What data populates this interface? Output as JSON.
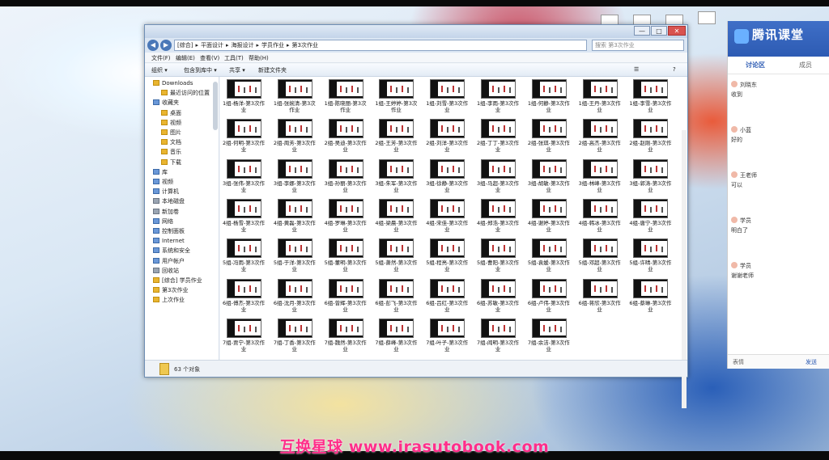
{
  "watermark": "互换星球 www.irasutobook.com",
  "window": {
    "address": [
      "[综合]",
      "平面设计",
      "海报设计",
      "学员作业",
      "第3次作业"
    ],
    "search_placeholder": "搜索 第3次作业",
    "controls": {
      "minimize": "—",
      "maximize": "□",
      "close": "✕"
    },
    "menu": [
      "文件(F)",
      "编辑(E)",
      "查看(V)",
      "工具(T)",
      "帮助(H)"
    ],
    "toolbar": [
      "组织 ▾",
      "包含到库中 ▾",
      "共享 ▾",
      "新建文件夹"
    ],
    "nav": [
      {
        "label": "Downloads",
        "icon": "folder-icon"
      },
      {
        "label": "最近访问的位置",
        "icon": "folder-icon"
      },
      {
        "label": "收藏夹",
        "icon": "star-icon"
      },
      {
        "label": "桌面",
        "icon": "folder-icon"
      },
      {
        "label": "视频",
        "icon": "folder-icon"
      },
      {
        "label": "图片",
        "icon": "folder-icon"
      },
      {
        "label": "文档",
        "icon": "folder-icon"
      },
      {
        "label": "音乐",
        "icon": "folder-icon"
      },
      {
        "label": "下载",
        "icon": "folder-icon"
      },
      {
        "label": "库",
        "icon": "library-icon"
      },
      {
        "label": "视频",
        "icon": "library-icon"
      },
      {
        "label": "计算机",
        "icon": "computer-icon"
      },
      {
        "label": "本地磁盘",
        "icon": "drive-icon"
      },
      {
        "label": "新加卷",
        "icon": "drive-icon"
      },
      {
        "label": "网络",
        "icon": "network-icon"
      },
      {
        "label": "控制面板",
        "icon": "control-icon"
      },
      {
        "label": "Internet",
        "icon": "control-icon"
      },
      {
        "label": "系统和安全",
        "icon": "control-icon"
      },
      {
        "label": "用户帐户",
        "icon": "control-icon"
      },
      {
        "label": "回收站",
        "icon": "recycle-icon"
      },
      {
        "label": "[综合] 学员作业",
        "icon": "folder-icon"
      },
      {
        "label": "第3次作业",
        "icon": "folder-icon"
      },
      {
        "label": "上次作业",
        "icon": "folder-icon"
      }
    ],
    "files": [
      "1组-杨洋-第3次作业",
      "1组-张婉清-第3次作业",
      "1组-陈晓丽-第3次作业",
      "1组-王婷婷-第3次作业",
      "1组-刘雪-第3次作业",
      "1组-李雨-第3次作业",
      "1组-何静-第3次作业",
      "1组-王丹-第3次作业",
      "1组-李雪-第3次作业",
      "2组-何明-第3次作业",
      "2组-周芳-第3次作业",
      "2组-吴迪-第3次作业",
      "2组-王芳-第3次作业",
      "2组-刘洋-第3次作业",
      "2组-丁丁-第3次作业",
      "2组-张琪-第3次作业",
      "2组-高杰-第3次作业",
      "2组-赵刚-第3次作业",
      "3组-张伟-第3次作业",
      "3组-李娜-第3次作业",
      "3组-孙丽-第3次作业",
      "3组-朱军-第3次作业",
      "3组-徐静-第3次作业",
      "3组-马超-第3次作业",
      "3组-胡敏-第3次作业",
      "3组-林峰-第3次作业",
      "3组-郭涛-第3次作业",
      "4组-杨雪-第3次作业",
      "4组-黄磊-第3次作业",
      "4组-罗琳-第3次作业",
      "4组-梁晨-第3次作业",
      "4组-宋佳-第3次作业",
      "4组-郑浩-第3次作业",
      "4组-谢婷-第3次作业",
      "4组-韩冰-第3次作业",
      "4组-唐宁-第3次作业",
      "5组-冯雨-第3次作业",
      "5组-于洋-第3次作业",
      "5组-董明-第3次作业",
      "5组-萧然-第3次作业",
      "5组-程亮-第3次作业",
      "5组-曹阳-第3次作业",
      "5组-袁媛-第3次作业",
      "5组-邓超-第3次作业",
      "5组-许晴-第3次作业",
      "6组-傅杰-第3次作业",
      "6组-沈月-第3次作业",
      "6组-曾辉-第3次作业",
      "6组-彭飞-第3次作业",
      "6组-吕红-第3次作业",
      "6组-苏敏-第3次作业",
      "6组-卢伟-第3次作业",
      "6组-蒋欣-第3次作业",
      "6组-蔡琳-第3次作业",
      "7组-贾宁-第3次作业",
      "7组-丁香-第3次作业",
      "7组-魏然-第3次作业",
      "7组-薛峰-第3次作业",
      "7组-叶子-第3次作业",
      "7组-阎明-第3次作业",
      "7组-余洁-第3次作业"
    ],
    "status": "63 个对象"
  },
  "panel": {
    "brand": "腾讯课堂",
    "tabs": [
      "讨论区",
      "成员"
    ],
    "chats": [
      {
        "name": "刘晓东",
        "text": "收到"
      },
      {
        "name": "小蓝",
        "text": "好的"
      },
      {
        "name": "王老师",
        "text": "可以"
      },
      {
        "name": "学员",
        "text": "明白了"
      },
      {
        "name": "学员",
        "text": "谢谢老师"
      }
    ],
    "footer": [
      "表情",
      "发送"
    ]
  }
}
